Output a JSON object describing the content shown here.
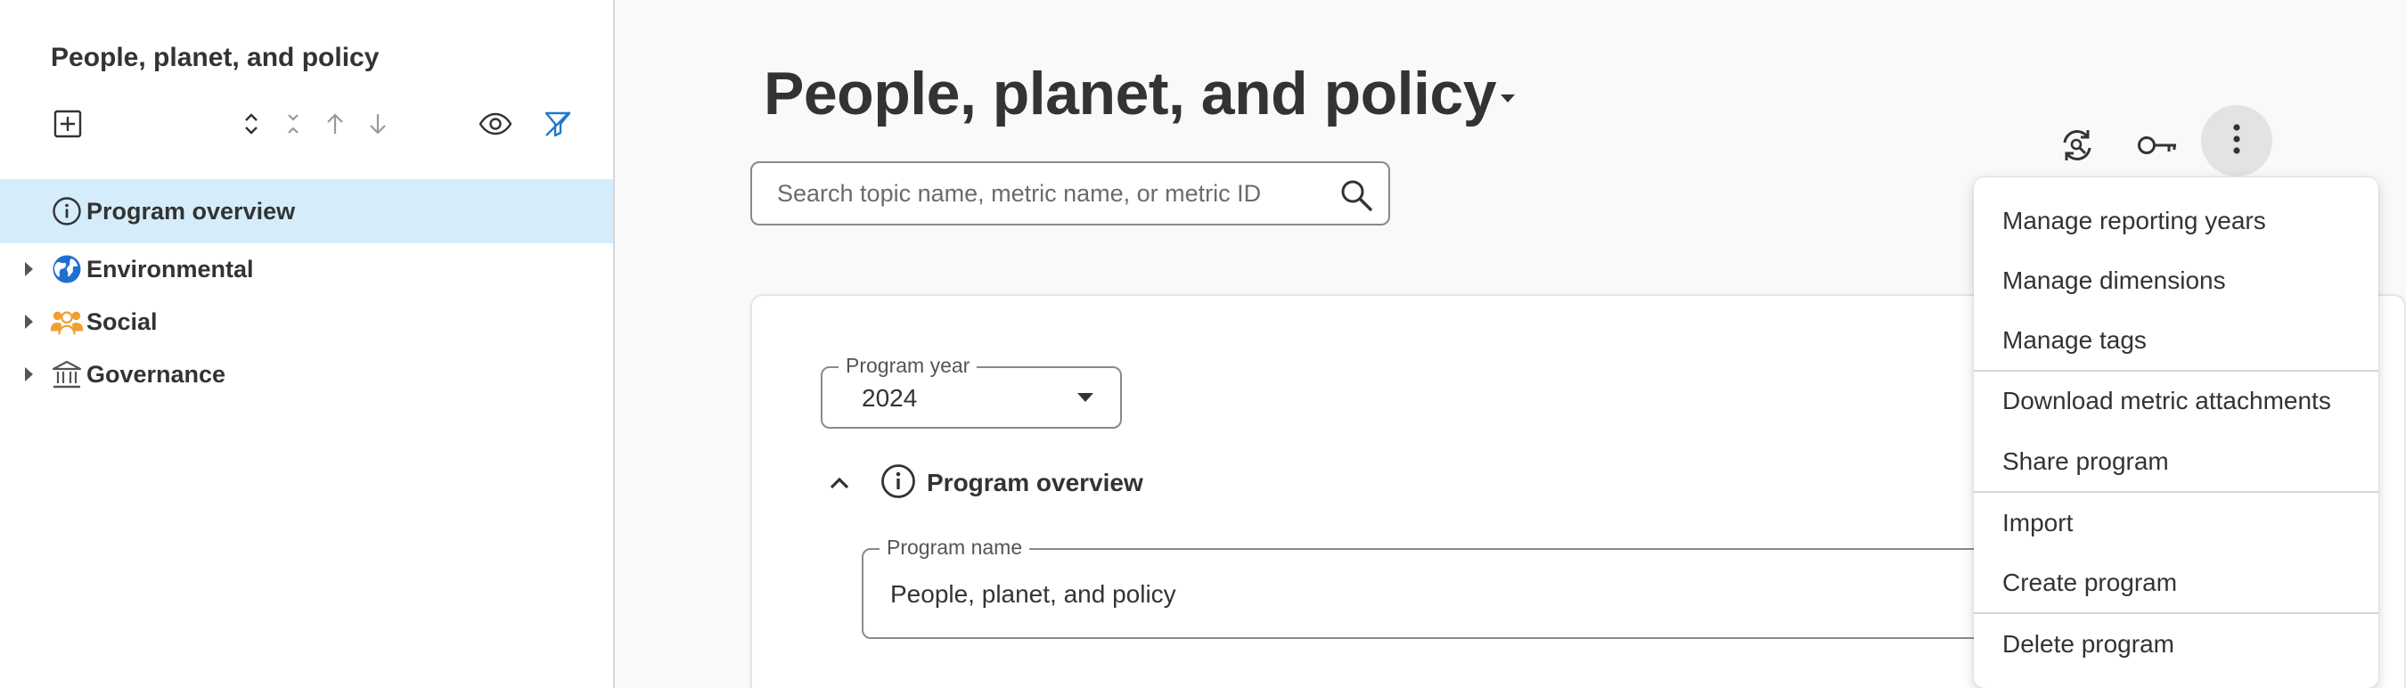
{
  "sidebar": {
    "title": "People, planet, and policy",
    "tree": [
      {
        "label": "Program overview",
        "icon": "info-icon",
        "selected": true
      },
      {
        "label": "Environmental",
        "icon": "globe-icon"
      },
      {
        "label": "Social",
        "icon": "people-icon"
      },
      {
        "label": "Governance",
        "icon": "bank-icon"
      }
    ]
  },
  "header": {
    "title": "People, planet, and policy"
  },
  "search": {
    "placeholder": "Search topic name, metric name, or metric ID"
  },
  "program_year": {
    "label": "Program year",
    "value": "2024"
  },
  "section": {
    "title": "Program overview"
  },
  "program_name": {
    "label": "Program name",
    "value": "People, planet, and policy"
  },
  "menu": {
    "items": [
      "Manage reporting years",
      "Manage dimensions",
      "Manage tags",
      "Download metric attachments",
      "Share program",
      "Import",
      "Create program",
      "Delete program"
    ]
  },
  "colors": {
    "selected_bg": "#d5ecfb",
    "accent_blue": "#1f7ac9",
    "social_orange": "#f0a030",
    "more_button_bg": "#e3e3e3"
  }
}
